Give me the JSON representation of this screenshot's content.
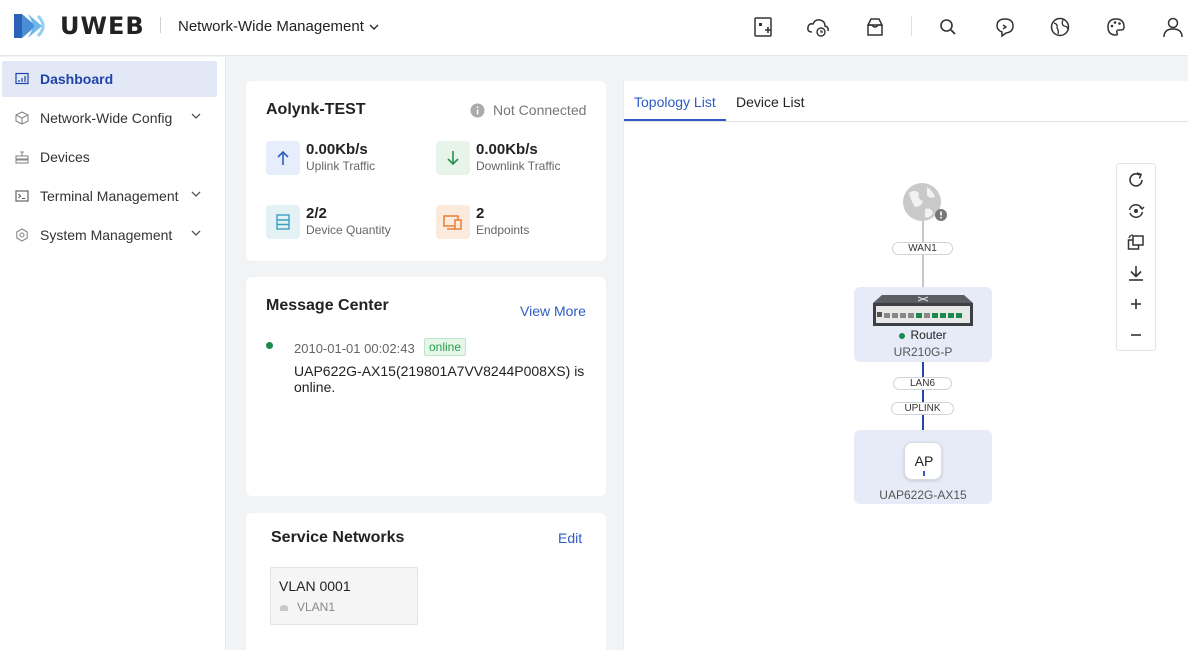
{
  "header": {
    "brand": "UWEB",
    "scope_label": "Network-Wide Management",
    "icons": [
      "add-device-icon",
      "cloud-icon",
      "mailbox-icon",
      "search-icon",
      "feedback-icon",
      "language-icon",
      "theme-icon",
      "user-icon"
    ]
  },
  "sidebar": {
    "items": [
      {
        "label": "Dashboard",
        "icon": "dashboard-icon",
        "active": true
      },
      {
        "label": "Network-Wide Config",
        "icon": "cube-icon",
        "expandable": true
      },
      {
        "label": "Devices",
        "icon": "devices-icon"
      },
      {
        "label": "Terminal Management",
        "icon": "terminal-icon",
        "expandable": true
      },
      {
        "label": "System Management",
        "icon": "gear-icon",
        "expandable": true
      }
    ]
  },
  "site": {
    "name": "Aolynk-TEST",
    "status": "Not Connected",
    "uplink_value": "0.00Kb/s",
    "uplink_label": "Uplink Traffic",
    "downlink_value": "0.00Kb/s",
    "downlink_label": "Downlink Traffic",
    "device_value": "2/2",
    "device_label": "Device Quantity",
    "endpoint_value": "2",
    "endpoint_label": "Endpoints"
  },
  "messages": {
    "title": "Message Center",
    "view_more": "View More",
    "items": [
      {
        "time": "2010-01-01 00:02:43",
        "badge": "online",
        "text": "UAP622G-AX15(219801A7VV8244P008XS) is online."
      }
    ]
  },
  "service": {
    "title": "Service Networks",
    "edit": "Edit",
    "vlans": [
      {
        "name": "VLAN 0001",
        "sub": "VLAN1"
      }
    ]
  },
  "topology": {
    "tabs": [
      "Topology List",
      "Device List"
    ],
    "wan_label": "WAN1",
    "router_name": "Router",
    "router_model": "UR210G-P",
    "lan_label": "LAN6",
    "uplink_label": "UPLINK",
    "ap_text": "AP",
    "ap_model": "UAP622G-AX15",
    "toolbar": [
      "refresh-icon",
      "sync-icon",
      "rotate-icon",
      "download-icon",
      "zoom-in-icon",
      "zoom-out-icon"
    ],
    "colors": {
      "link": "#2f5bc4",
      "online": "#1a8a4c"
    }
  }
}
